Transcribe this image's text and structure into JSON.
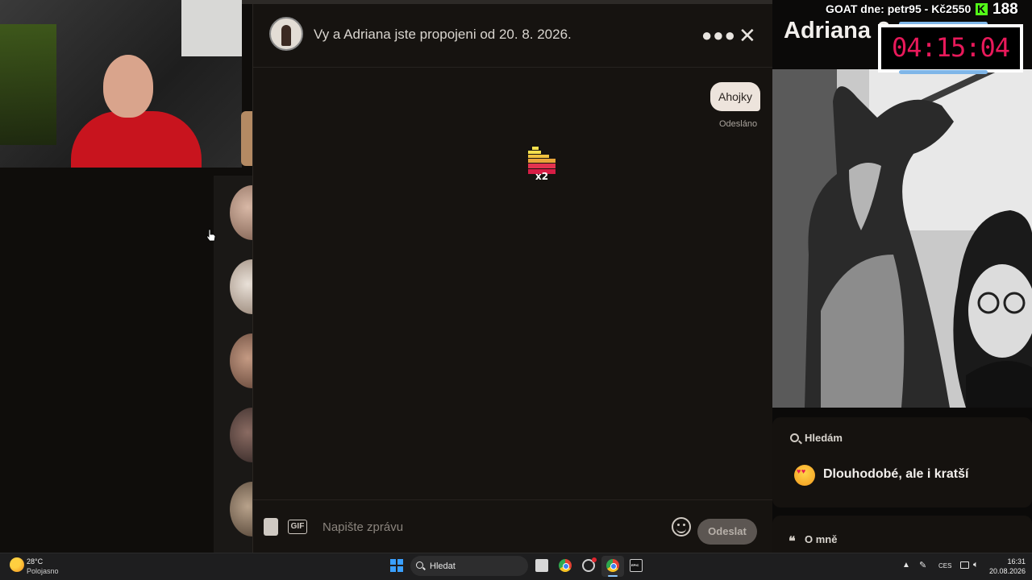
{
  "chat": {
    "title": "Vy a Adriana jste propojeni od 20. 8. 2026.",
    "messages": [
      {
        "text": "Ahojky",
        "status": "Odesláno",
        "direction": "sent"
      }
    ],
    "badge_text": "x2",
    "composer": {
      "gif_label": "GIF",
      "placeholder": "Napište zprávu",
      "value": "",
      "send_label": "Odeslat"
    },
    "icons": {
      "more": "more-dots-icon",
      "close": "close-icon",
      "contact": "contact-card-icon",
      "emoji": "emoji-icon"
    }
  },
  "profile": {
    "name": "Adriana 2",
    "looking_for_label": "Hledám",
    "looking_for_value": "Dlouhodobé, ale i kratší",
    "about_label": "O mně"
  },
  "overlay": {
    "goat_text": "GOAT dne: petr95 - Kč2550",
    "viewer_count": "188",
    "timer": "04:15:04",
    "timer_color": "#e8195a",
    "kick_color": "#53fc18"
  },
  "taskbar": {
    "weather_temp": "28°C",
    "weather_desc": "Polojasno",
    "search_label": "Hledat",
    "language": "CES",
    "time": "16:31",
    "date": "20.08.2026"
  }
}
